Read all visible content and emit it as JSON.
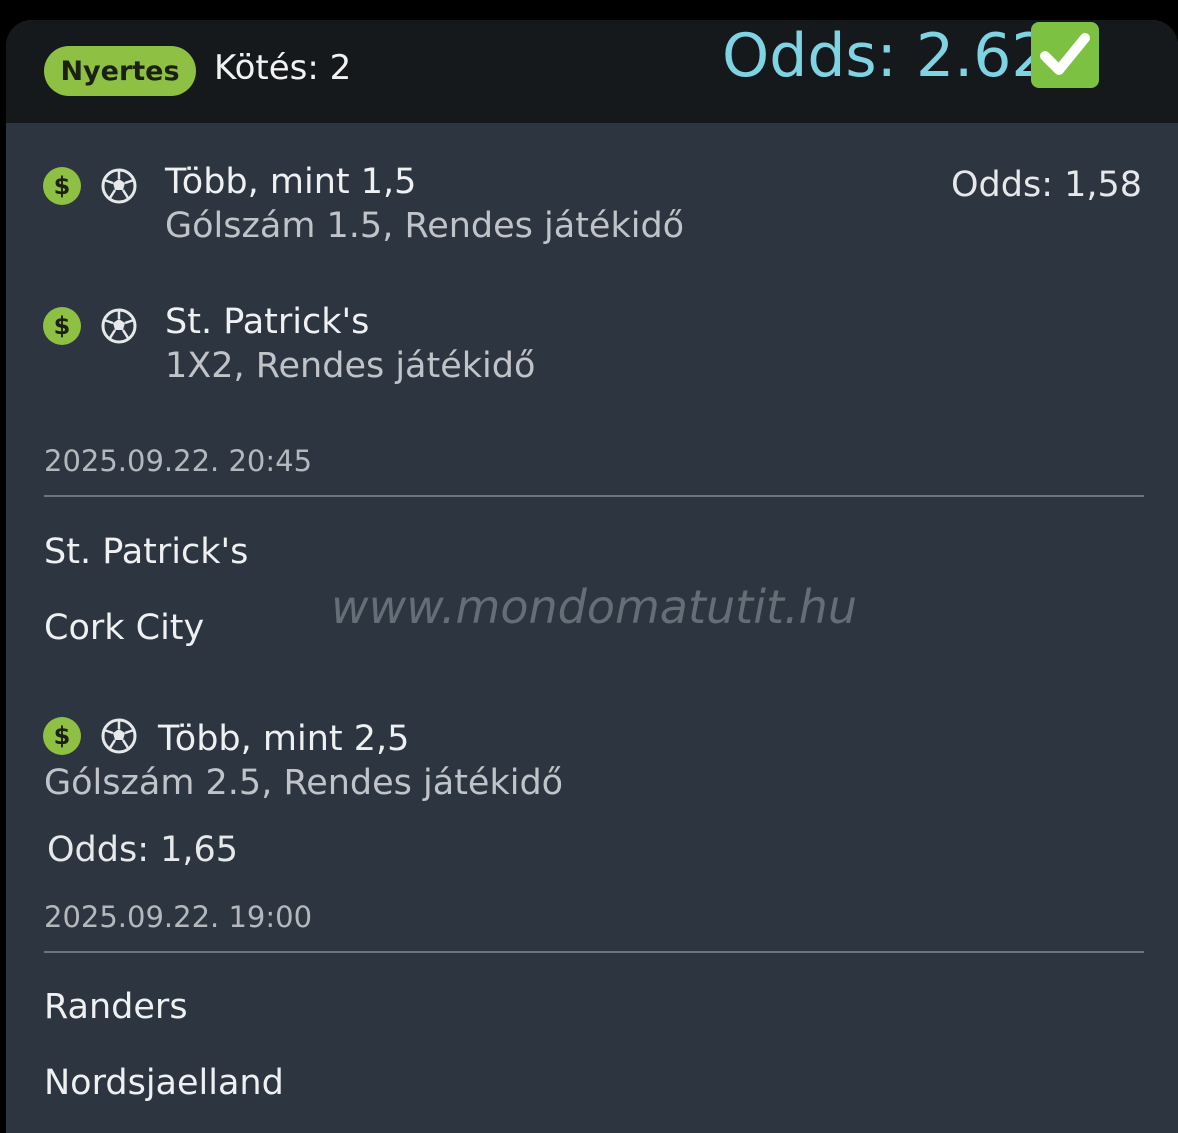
{
  "header": {
    "status_badge": "Nyertes",
    "kotes_label": "Kötés: 2",
    "total_odds": "Odds: 2.62",
    "check_icon": "check-mark-icon"
  },
  "colors": {
    "badge_green": "#8dc043",
    "odds_cyan": "#7fd4e4",
    "card_bg": "#2c3540",
    "header_bg": "#16191c"
  },
  "bets": [
    {
      "selections": [
        {
          "title": "Több, mint 1,5",
          "market": "Gólszám 1.5, Rendes játékidő",
          "odds": "Odds: 1,58",
          "icons": [
            "dollar-icon",
            "soccer-ball-icon"
          ]
        },
        {
          "title": "St. Patrick's",
          "market": "1X2, Rendes játékidő",
          "icons": [
            "dollar-icon",
            "soccer-ball-icon"
          ]
        }
      ],
      "datetime": "2025.09.22.  20:45",
      "home": "St. Patrick's",
      "away": "Cork City"
    },
    {
      "selections": [
        {
          "title": "Több, mint 2,5",
          "market": "Gólszám 2.5, Rendes játékidő",
          "odds": "Odds: 1,65",
          "icons": [
            "dollar-icon",
            "soccer-ball-icon"
          ]
        }
      ],
      "datetime": "2025.09.22.  19:00",
      "home": "Randers",
      "away": "Nordsjaelland"
    }
  ],
  "watermark": "www.mondomatutit.hu"
}
